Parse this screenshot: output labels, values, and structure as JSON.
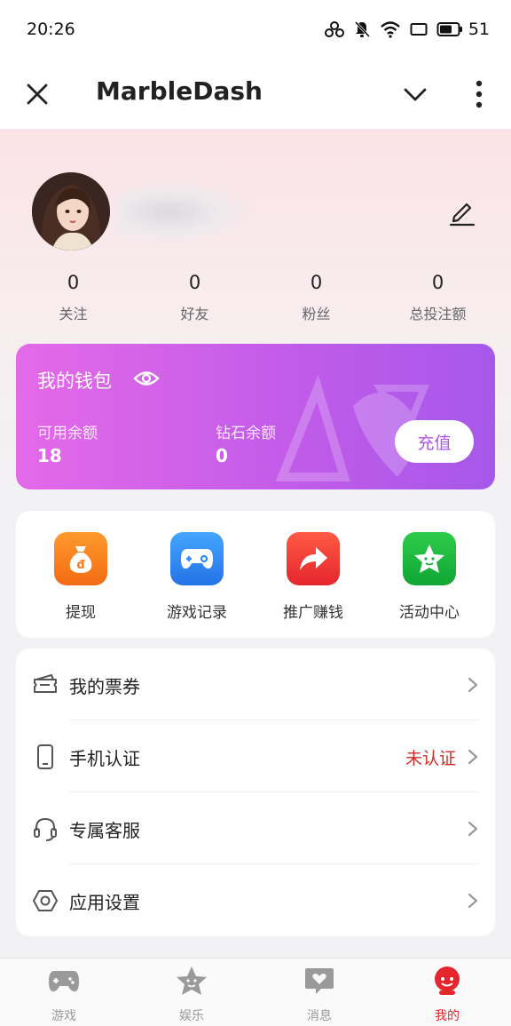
{
  "status_bar": {
    "time": "20:26",
    "battery": "51"
  },
  "titlebar": {
    "title": "MarbleDash"
  },
  "profile": {
    "stats": [
      {
        "value": "0",
        "label": "关注"
      },
      {
        "value": "0",
        "label": "好友"
      },
      {
        "value": "0",
        "label": "粉丝"
      },
      {
        "value": "0",
        "label": "总投注额"
      }
    ]
  },
  "wallet": {
    "title": "我的钱包",
    "available_label": "可用余额",
    "available_value": "18",
    "diamond_label": "钻石余额",
    "diamond_value": "0",
    "recharge_label": "充值"
  },
  "quick_actions": [
    {
      "label": "提现",
      "icon": "money-bag-icon",
      "color": "#f57a1f"
    },
    {
      "label": "游戏记录",
      "icon": "gamepad-icon",
      "color": "#2d8df0"
    },
    {
      "label": "推广赚钱",
      "icon": "share-arrow-icon",
      "color": "#ee3a2c"
    },
    {
      "label": "活动中心",
      "icon": "star-icon",
      "color": "#16b13c"
    }
  ],
  "menu": [
    {
      "label": "我的票券",
      "icon": "ticket-icon",
      "status": ""
    },
    {
      "label": "手机认证",
      "icon": "phone-icon",
      "status": "未认证"
    },
    {
      "label": "专属客服",
      "icon": "headset-icon",
      "status": ""
    },
    {
      "label": "应用设置",
      "icon": "settings-icon",
      "status": ""
    }
  ],
  "tabs": [
    {
      "label": "游戏",
      "icon": "gamepad-tab-icon",
      "active": false
    },
    {
      "label": "娱乐",
      "icon": "star-tab-icon",
      "active": false
    },
    {
      "label": "消息",
      "icon": "message-tab-icon",
      "active": false
    },
    {
      "label": "我的",
      "icon": "profile-tab-icon",
      "active": true
    }
  ],
  "colors": {
    "accent_red": "#e5262d",
    "wallet_gradient_start": "#e46ae8",
    "wallet_gradient_end": "#a658ea",
    "warning_text": "#d42a2a"
  }
}
